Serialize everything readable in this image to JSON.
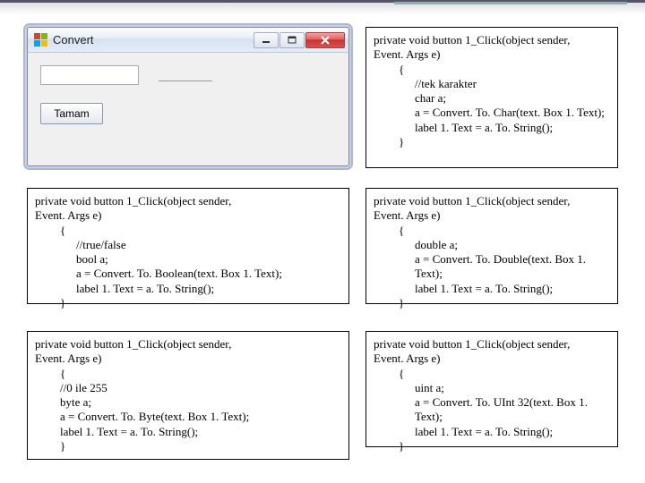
{
  "window": {
    "title": "Convert",
    "button_label": "Tamam"
  },
  "snippets": {
    "s1": {
      "l0": "private void button 1_Click(object sender,",
      "l1": "Event. Args e)",
      "l2": "{",
      "l3": "//tek karakter",
      "l4": "char a;",
      "l5": "a = Convert. To. Char(text. Box 1. Text);",
      "l6": "label 1. Text = a. To. String();",
      "l7": "}"
    },
    "s2": {
      "l0": "private void button 1_Click(object sender,",
      "l1": "Event. Args e)",
      "l2": "{",
      "l3": "//true/false",
      "l4": "bool a;",
      "l5": "a = Convert. To. Boolean(text. Box 1. Text);",
      "l6": "label 1. Text = a. To. String();",
      "l7": "}"
    },
    "s3": {
      "l0": "private void button 1_Click(object sender,",
      "l1": "Event. Args e)",
      "l2": "{",
      "l3": "double a;",
      "l4": "a = Convert. To. Double(text. Box 1. Text);",
      "l5": "label 1. Text = a. To. String();",
      "l6": "}"
    },
    "s4": {
      "l0": "private void button 1_Click(object sender,",
      "l1": "Event. Args e)",
      "l2": "{",
      "l3": "//0 ile 255",
      "l4": "byte a;",
      "l5": "a = Convert. To. Byte(text. Box 1. Text);",
      "l6": "label 1. Text = a. To. String();",
      "l7": "}"
    },
    "s5": {
      "l0": "private void button 1_Click(object sender,",
      "l1": "Event. Args e)",
      "l2": "{",
      "l3": "uint a;",
      "l4": "a = Convert. To. UInt 32(text. Box 1. Text);",
      "l5": "label 1. Text = a. To. String();",
      "l6": "}"
    }
  }
}
